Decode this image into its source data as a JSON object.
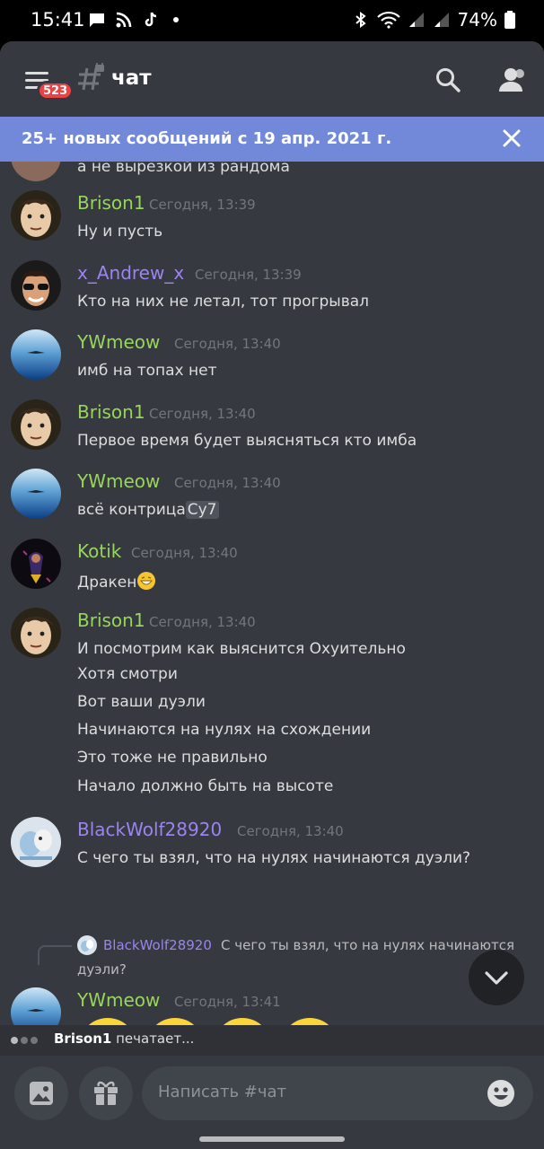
{
  "status_bar": {
    "time": "15:41",
    "battery": "74%"
  },
  "header": {
    "notification_badge": "523",
    "channel_name": "чат"
  },
  "banner": {
    "text": "25+ новых сообщений с 19 апр. 2021 г."
  },
  "cut_message": {
    "text": "а не вырезкой из рандома"
  },
  "messages": [
    {
      "username": "Brison1",
      "timestamp": "Сегодня, 13:39",
      "lines": [
        "Ну и пусть"
      ]
    },
    {
      "username": "x_Andrew_x",
      "timestamp": "Сегодня, 13:39",
      "lines": [
        "Кто на них не летал, тот прогрывал"
      ]
    },
    {
      "username": "YWmeow",
      "timestamp": "Сегодня, 13:40",
      "lines": [
        "имб на топах нет"
      ]
    },
    {
      "username": "Brison1",
      "timestamp": "Сегодня, 13:40",
      "lines": [
        "Первое время будет выясняться кто имба"
      ]
    },
    {
      "username": "YWmeow",
      "timestamp": "Сегодня, 13:40",
      "lines": [
        "всё контрица"
      ],
      "highlight": "Су7"
    },
    {
      "username": "Kotik",
      "timestamp": "Сегодня, 13:40",
      "lines": [
        "Дракен"
      ]
    },
    {
      "username": "Brison1",
      "timestamp": "Сегодня, 13:40",
      "lines": [
        "И посмотрим как выяснится Охуительно",
        "Хотя смотри",
        "Вот ваши дуэли",
        "Начинаются на нулях на схождении",
        "Это тоже не правильно",
        "Начало должно быть на высоте"
      ]
    },
    {
      "username": "BlackWolf28920",
      "timestamp": "Сегодня, 13:40",
      "lines": [
        "С чего ты взял, что на нулях начинаются дуэли?"
      ]
    },
    {
      "username": "YWmeow",
      "timestamp": "Сегодня, 13:41",
      "lines": []
    }
  ],
  "reply": {
    "username": "BlackWolf28920",
    "text": "С чего ты взял, что на нулях начинаются",
    "text_cont": "дуэли?"
  },
  "typing": {
    "user": "Brison1",
    "suffix": "печатает..."
  },
  "composer": {
    "placeholder": "Написать #чат"
  },
  "colors": {
    "background": "#36393f",
    "banner": "#7289da",
    "green_name": "#97d55b",
    "purple_name": "#9b84ee",
    "badge": "#ed4245"
  },
  "icons": [
    "menu-icon",
    "channel-hash-lock-icon",
    "search-icon",
    "members-icon",
    "close-icon",
    "chevron-down-icon",
    "image-icon",
    "gift-icon",
    "emoji-icon",
    "joy-emoji"
  ]
}
